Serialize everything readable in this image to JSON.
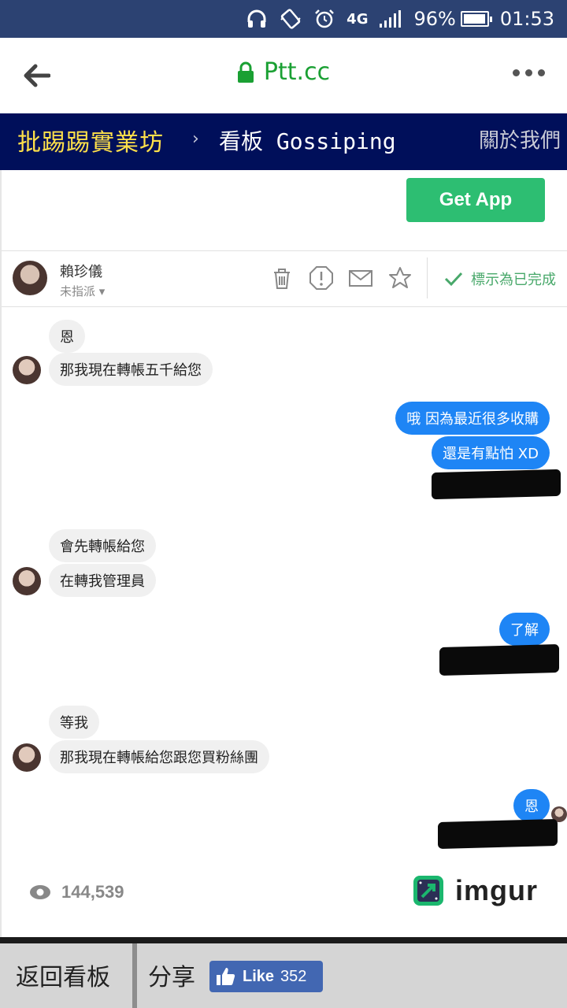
{
  "status_bar": {
    "battery_percent_label": "96%",
    "battery_level": 0.96,
    "time": "01:53",
    "network_label": "4G",
    "icons": [
      "headphones-icon",
      "vibrate-icon",
      "alarm-icon",
      "network-4g-icon",
      "signal-icon",
      "battery-icon"
    ]
  },
  "browser": {
    "url": "Ptt.cc",
    "back_icon": "arrow-left-icon",
    "lock_icon": "lock-icon",
    "menu_icon": "more-dots-icon",
    "url_color": "#1aa033"
  },
  "ptt_header": {
    "logo": "批踢踢實業坊",
    "separator": "›",
    "board": "看板 Gossiping",
    "about": "關於我們",
    "bg_color": "#000f5a",
    "logo_color": "#ffe04a"
  },
  "screenshot": {
    "get_app_label": "Get App",
    "contact": {
      "name": "賴珍儀",
      "assign_label": "未指派"
    },
    "toolbar_icons": [
      "trash-icon",
      "alert-icon",
      "mail-icon",
      "star-icon"
    ],
    "done_label": "標示為已完成",
    "messages": [
      {
        "from": "them",
        "text": "恩"
      },
      {
        "from": "them",
        "text": "那我現在轉帳五千給您"
      },
      {
        "from": "me",
        "text": "哦 因為最近很多收購"
      },
      {
        "from": "me",
        "text": "還是有點怕 XD"
      },
      {
        "from": "them",
        "text": "會先轉帳給您"
      },
      {
        "from": "them",
        "text": "在轉我管理員"
      },
      {
        "from": "me",
        "text": "了解"
      },
      {
        "from": "them",
        "text": "等我"
      },
      {
        "from": "them",
        "text": "那我現在轉帳給您跟您買粉絲團"
      },
      {
        "from": "me",
        "text": "恩"
      }
    ],
    "views": "144,539",
    "views_icon": "eye-icon",
    "imgur_brand": "imgur",
    "out_bubble_color": "#1e85f5",
    "in_bubble_color": "#f0f0f0"
  },
  "bottom_bar": {
    "back_label": "返回看板",
    "share_label": "分享",
    "like_label": "Like",
    "like_count": "352",
    "like_color": "#4267b2"
  }
}
